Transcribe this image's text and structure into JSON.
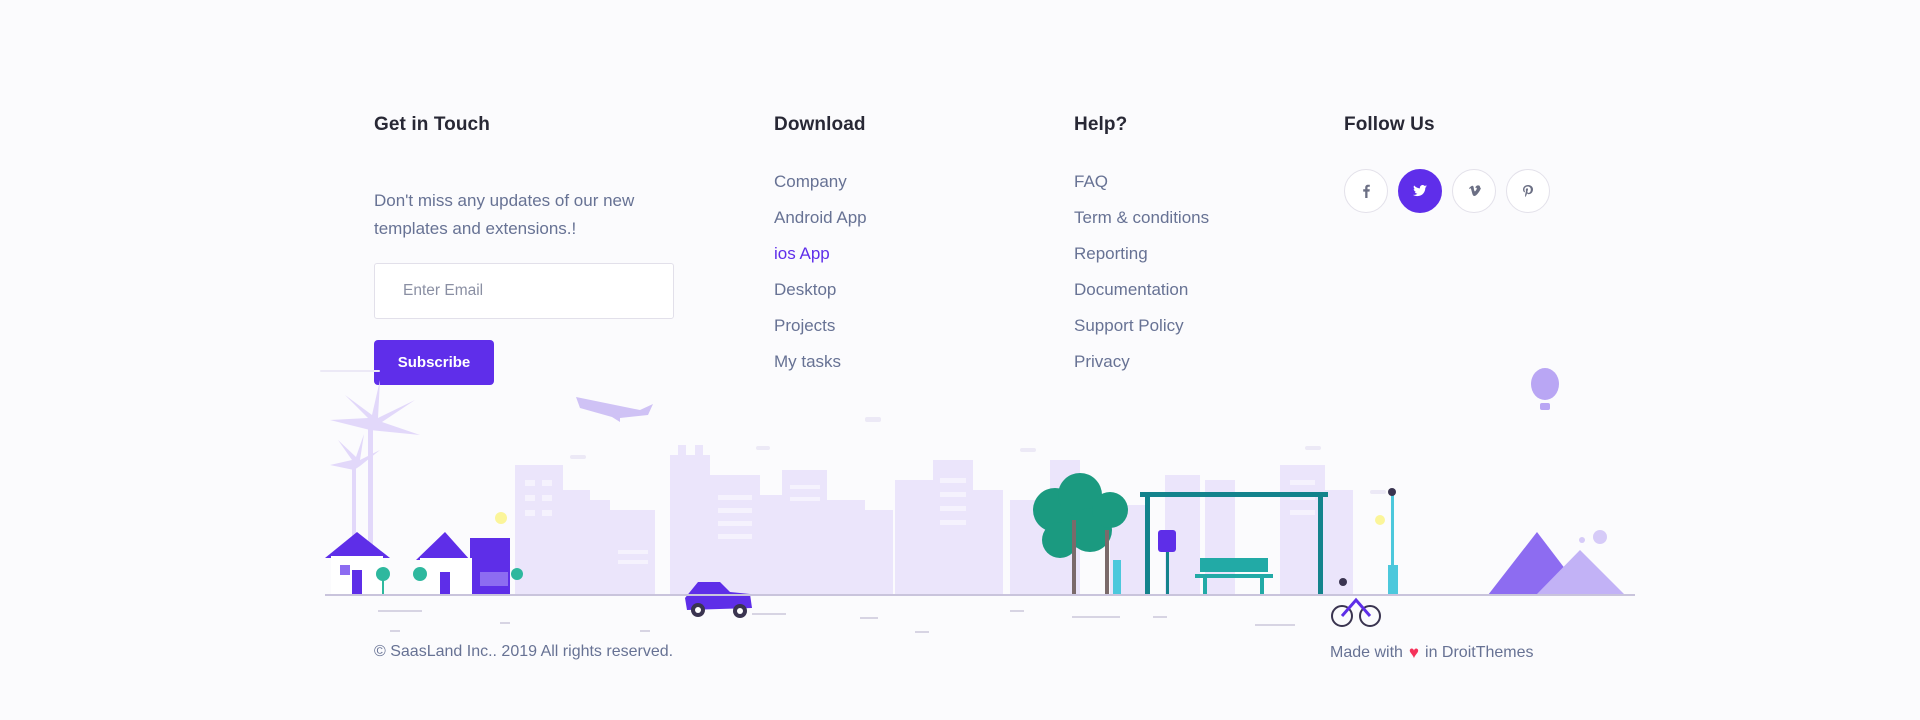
{
  "touch": {
    "title": "Get in Touch",
    "description": "Don't miss any updates of our new templates and extensions.!",
    "email_placeholder": "Enter Email",
    "subscribe_label": "Subscribe"
  },
  "download": {
    "title": "Download",
    "items": [
      "Company",
      "Android App",
      "ios App",
      "Desktop",
      "Projects",
      "My tasks"
    ],
    "active_item": "ios App"
  },
  "help": {
    "title": "Help?",
    "items": [
      "FAQ",
      "Term & conditions",
      "Reporting",
      "Documentation",
      "Support Policy",
      "Privacy"
    ]
  },
  "follow": {
    "title": "Follow Us",
    "icons": [
      {
        "name": "facebook-icon",
        "glyph": "f"
      },
      {
        "name": "twitter-icon",
        "glyph": "✓"
      },
      {
        "name": "vimeo-icon",
        "glyph": "v"
      },
      {
        "name": "pinterest-icon",
        "glyph": "p"
      }
    ],
    "active_icon": "twitter-icon"
  },
  "footer": {
    "copyright": "© SaasLand  Inc.. 2019 All rights reserved.",
    "made_prefix": "Made with",
    "made_suffix": "in DroitThemes"
  },
  "colors": {
    "accent": "#5f2eea",
    "text": "#677294",
    "heading": "#282835",
    "heart": "#f5315a",
    "city": "#e9e4fb",
    "tree": "#1b9a80",
    "bench": "#22aaa6"
  }
}
